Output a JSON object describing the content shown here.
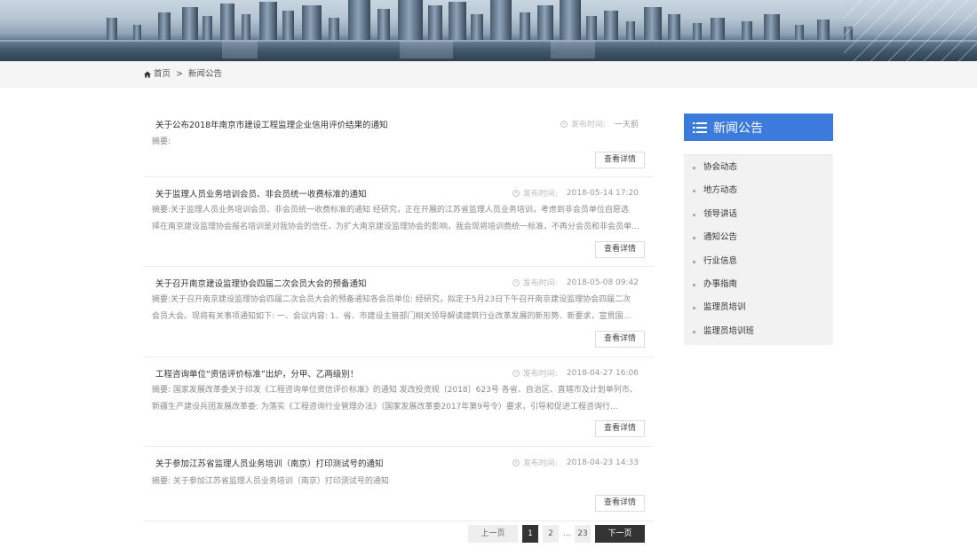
{
  "breadcrumb": {
    "home": "首页",
    "separator": ">",
    "current": "新闻公告"
  },
  "articles": [
    {
      "title": "关于公布2018年南京市建设工程监理企业信用评价结果的通知",
      "date_label": "发布时间:",
      "date": "一天前",
      "summary": [
        "摘要:"
      ],
      "button": "查看详情"
    },
    {
      "title": "关于监理人员业务培训会员、非会员统一收费标准的通知",
      "date_label": "发布时间:",
      "date": "2018-05-14 17:20",
      "summary": [
        "摘要:关于监理人员业务培训会员、非会员统一收费标准的通知  经研究，正在开展的江苏省监理人员业务培训，考虑到非会员单位自愿选",
        "择在南京建设监理协会报名培训是对我协会的信任，为扩大南京建设监理协会的影响，我会现将培训费统一标准，不再分会员和非会员单..."
      ],
      "button": "查看详情"
    },
    {
      "title": "关于召开南京建设监理协会四届二次会员大会的预备通知",
      "date_label": "发布时间:",
      "date": "2018-05-08 09:42",
      "summary": [
        "摘要:关于召开南京建设监理协会四届二次会员大会的预备通知各会员单位: 经研究，拟定于5月23日下午召开南京建设监理协会四届二次",
        "会员大会。现将有关事项通知如下: 一、会议内容: 1、省、市建设主管部门相关领导解读建筑行业改革发展的新形势、新要求，宣贯国..."
      ],
      "button": "查看详情"
    },
    {
      "title": "工程咨询单位“资信评价标准”出炉，分甲、乙两级别！",
      "date_label": "发布时间:",
      "date": "2018-04-27 16:06",
      "summary": [
        "摘要: 国家发展改革委关于印发《工程咨询单位资信评价标准》的通知 发改投资规〔2018〕623号 各省、自治区、直辖市及计划单列市、",
        "新疆生产建设兵团发展改革委:        为落实《工程咨询行业管理办法》（国家发展改革委2017年第9号令）要求，引导和促进工程咨询行..."
      ],
      "button": "查看详情"
    },
    {
      "title": "关于参加江苏省监理人员业务培训（南京）打印测试号的通知",
      "date_label": "发布时间:",
      "date": "2018-04-23 14:33",
      "summary": [
        "摘要: 关于参加江苏省监理人员业务培训（南京）打印测试号的通知"
      ],
      "button": "查看详情"
    }
  ],
  "pagination": {
    "prev": "上一页",
    "pages": [
      "1",
      "2"
    ],
    "dots": "...",
    "last": "23",
    "next": "下一页",
    "current": "1"
  },
  "sidebar": {
    "title": "新闻公告",
    "items": [
      "协会动态",
      "地方动态",
      "领导讲话",
      "通知公告",
      "行业信息",
      "办事指南",
      "监理员培训",
      "监理员培训班"
    ]
  },
  "colors": {
    "accent": "#3c7bdc",
    "pager_active": "#333333"
  }
}
